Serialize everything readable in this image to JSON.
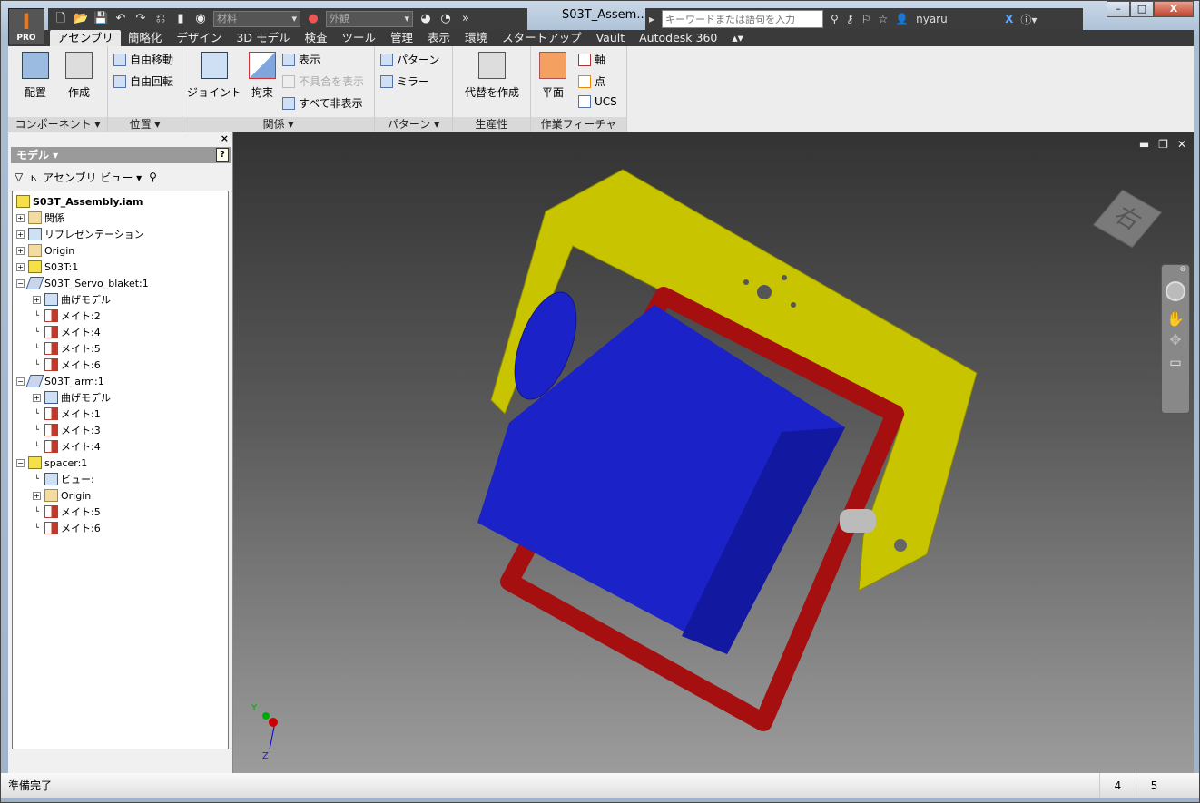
{
  "app": {
    "logo": "I",
    "edition": "PRO",
    "title": "S03T_Assem...",
    "status": "準備完了",
    "status_nums": [
      "4",
      "5"
    ]
  },
  "qat": {
    "material": "材料",
    "appearance": "外観"
  },
  "help": {
    "search_placeholder": "キーワードまたは語句を入力",
    "user": "nyaru"
  },
  "tabs": [
    "アセンブリ",
    "簡略化",
    "デザイン",
    "3D モデル",
    "検査",
    "ツール",
    "管理",
    "表示",
    "環境",
    "スタートアップ",
    "Vault",
    "Autodesk 360"
  ],
  "ribbon": {
    "component": {
      "label": "コンポーネント ▾",
      "place": "配置",
      "create": "作成"
    },
    "position": {
      "label": "位置 ▾",
      "free_move": "自由移動",
      "free_rotate": "自由回転"
    },
    "relationships": {
      "label": "関係 ▾",
      "joint": "ジョイント",
      "constrain": "拘束",
      "show": "表示",
      "show_sick": "不具合を表示",
      "hide_all": "すべて非表示"
    },
    "pattern": {
      "label": "パターン ▾",
      "pattern": "パターン",
      "mirror": "ミラー"
    },
    "productivity": {
      "label": "生産性",
      "substitute": "代替を作成"
    },
    "work_features": {
      "label": "作業フィーチャ",
      "plane": "平面",
      "axis": "軸",
      "point": "点",
      "ucs": "UCS"
    }
  },
  "browser": {
    "title": "モデル ▾",
    "help": "?",
    "view": "アセンブリ ビュー",
    "tree": [
      {
        "label": "S03T_Assembly.iam",
        "level": 0,
        "icon": "assembly",
        "pm": ""
      },
      {
        "label": "関係",
        "level": 1,
        "icon": "folder",
        "pm": "+"
      },
      {
        "label": "リプレゼンテーション",
        "level": 1,
        "icon": "fold",
        "pm": "+"
      },
      {
        "label": "Origin",
        "level": 1,
        "icon": "folder",
        "pm": "+"
      },
      {
        "label": "S03T:1",
        "level": 1,
        "icon": "part",
        "pm": "+"
      },
      {
        "label": "S03T_Servo_blaket:1",
        "level": 1,
        "icon": "sheet",
        "pm": "-"
      },
      {
        "label": "曲げモデル",
        "level": 2,
        "icon": "fold",
        "pm": "+"
      },
      {
        "label": "メイト:2",
        "level": 2,
        "icon": "mate",
        "pm": ""
      },
      {
        "label": "メイト:4",
        "level": 2,
        "icon": "mate",
        "pm": ""
      },
      {
        "label": "メイト:5",
        "level": 2,
        "icon": "mate",
        "pm": ""
      },
      {
        "label": "メイト:6",
        "level": 2,
        "icon": "mate",
        "pm": ""
      },
      {
        "label": "S03T_arm:1",
        "level": 1,
        "icon": "sheet",
        "pm": "-"
      },
      {
        "label": "曲げモデル",
        "level": 2,
        "icon": "fold",
        "pm": "+"
      },
      {
        "label": "メイト:1",
        "level": 2,
        "icon": "mate",
        "pm": ""
      },
      {
        "label": "メイト:3",
        "level": 2,
        "icon": "mate",
        "pm": ""
      },
      {
        "label": "メイト:4",
        "level": 2,
        "icon": "mate",
        "pm": ""
      },
      {
        "label": "spacer:1",
        "level": 1,
        "icon": "part",
        "pm": "-"
      },
      {
        "label": "ビュー:",
        "level": 2,
        "icon": "fold",
        "pm": ""
      },
      {
        "label": "Origin",
        "level": 2,
        "icon": "folder",
        "pm": "+"
      },
      {
        "label": "メイト:5",
        "level": 2,
        "icon": "mate",
        "pm": ""
      },
      {
        "label": "メイト:6",
        "level": 2,
        "icon": "mate",
        "pm": ""
      }
    ]
  },
  "viewport": {
    "viewcube_face": "右",
    "axis_y": "Y",
    "axis_z": "Z"
  },
  "colors": {
    "yellow": "#c8c400",
    "red": "#a50f0f",
    "blue": "#1a22c8"
  }
}
